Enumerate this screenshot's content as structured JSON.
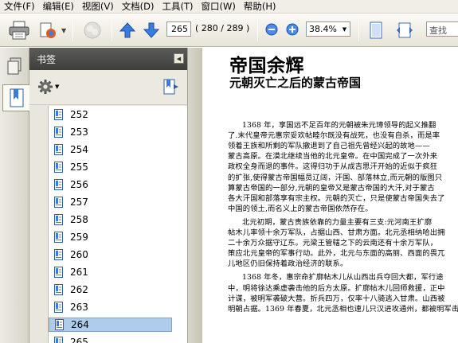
{
  "menu": [
    "文件(F)",
    "编辑(E)",
    "视图(V)",
    "文档(D)",
    "工具(T)",
    "窗口(W)",
    "帮助(H)"
  ],
  "toolbar": {
    "print_icon": "printer-icon",
    "current_page": "265",
    "page_count": "( 280 / 289 )",
    "zoom": "38.4%",
    "search_placeholder": "查找"
  },
  "panel": {
    "title": "书签",
    "options_icon": "gear-icon",
    "new_bookmark_icon": "new-bookmark-icon",
    "bookmarks": [
      "252",
      "253",
      "254",
      "255",
      "256",
      "257",
      "258",
      "259",
      "260",
      "261",
      "262",
      "263",
      "264",
      "265"
    ],
    "selected_bookmark": "264"
  },
  "document": {
    "title": "帝国余辉",
    "subtitle": "元朝灭亡之后的蒙古帝国",
    "lines": [
      "1368 年，享国远不足百年的元朝被朱元璋领导的起义推翻",
      "了.末代皇帝元惠宗妥欢帖睦尔既没有战死，也没有自杀，而是率",
      "领着王族和所剩的军队撤退到了自己祖先曾经兴起的故地——",
      "蒙古高原。在漠北继续当他的北元皇帝。在中国完成了一次外来",
      "政权全身而退的事件。这得归功于从成吉思汗开始的近似于疯狂",
      "的扩张,使得蒙古帝国幅员辽阔，汗国、部落林立,而元朝的版图只",
      "算蒙古帝国的一部分,元朝的皇帝又是蒙古帝国的大汗,对于蒙古",
      "各大汗国和部落享有宗主权。元朝的灭亡，只是使蒙古帝国失去了",
      "中国的领土,而名义上的蒙古帝国依然存在。",
      "北元初期，蒙古贵族依靠的力量主要有三支:元河南王扩廓",
      "帖木儿率领十余万军队，占据山西、甘肃方面。北元丞相纳哈出拥",
      "二十余万众据守辽东。元梁王管辖之下的云南还有十余万军队，",
      "策应北元皇帝的军事行动。此外，北元与东面的高丽、西面的畏兀",
      "儿地区仍旧保持着政治经济的联系。",
      "1368 年冬，惠宗命扩廓帖木儿从山西出兵夺回大都，军行途",
      "中，明将徐达乘虚袭击他的后方太原。扩廓帖木儿回师救援，正中",
      "计谋，被明军袭破大营。折兵四万，仅率十八骑逃入甘肃。山西被",
      "明朝占据。1369 年春夏，北元丞相也速儿只汉进攻通州，都被明军击"
    ]
  }
}
